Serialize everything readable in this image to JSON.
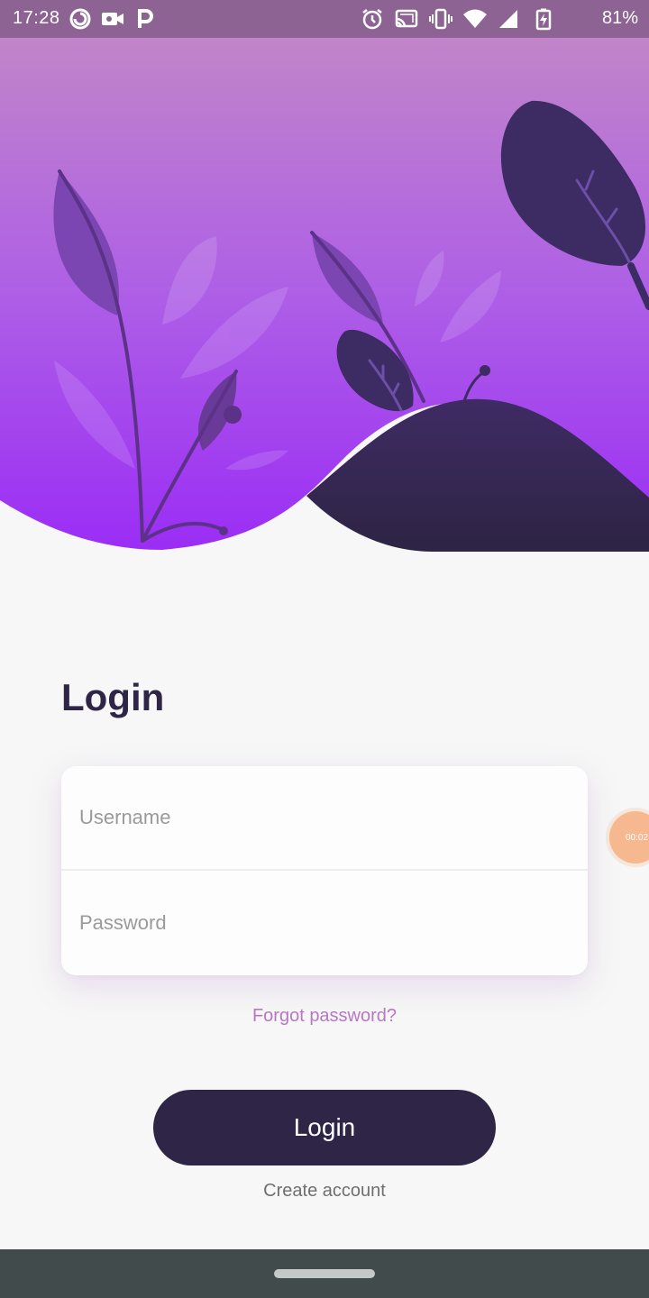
{
  "status_bar": {
    "time": "17:28",
    "battery": "81%",
    "left_icons": [
      "pocketcasts-icon",
      "video-camera-icon",
      "parking-icon"
    ],
    "right_icons": [
      "alarm-icon",
      "cast-icon",
      "vibrate-icon",
      "wifi-icon",
      "cell-signal-icon",
      "battery-charging-icon"
    ]
  },
  "colors": {
    "accent_dark": "#2e2547",
    "gradient_top": "#c185c9",
    "gradient_bottom": "#9b2df5",
    "link": "#b877c4"
  },
  "login": {
    "title": "Login",
    "username_placeholder": "Username",
    "password_placeholder": "Password",
    "forgot": "Forgot password?",
    "button": "Login",
    "create_account": "Create account"
  },
  "recorder": {
    "time": "00:02"
  }
}
